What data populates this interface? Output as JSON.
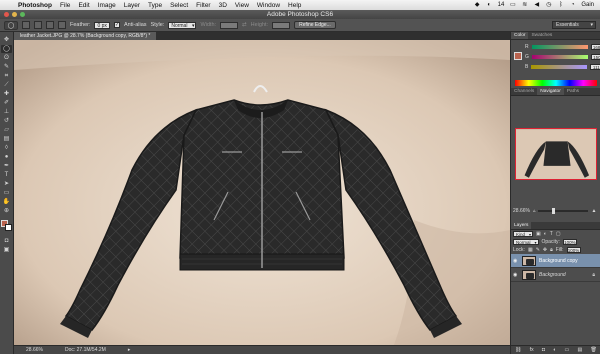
{
  "menubar": {
    "app_name": "Photoshop",
    "items": [
      "File",
      "Edit",
      "Image",
      "Layer",
      "Type",
      "Select",
      "Filter",
      "3D",
      "View",
      "Window",
      "Help"
    ],
    "status_number": "14",
    "user": "Gain"
  },
  "titlebar": {
    "title": "Adobe Photoshop CS6"
  },
  "options": {
    "feather_label": "Feather:",
    "feather_value": "0 px",
    "antialias_label": "Anti-alias",
    "style_label": "Style:",
    "style_value": "Normal",
    "width_label": "Width:",
    "height_label": "Height:",
    "refine_edge": "Refine Edge...",
    "workspace": "Essentials"
  },
  "document": {
    "tab_title": "leather Jacket.JPG @ 28.7% (Background copy, RGB/8*) *",
    "status_zoom": "28.66%",
    "status_doc": "Doc: 27.1M/54.2M"
  },
  "panels": {
    "color_tabs": [
      "Color",
      "Swatches"
    ],
    "color_values": {
      "r": "168",
      "g": "150",
      "b": "111"
    },
    "nav_tabs": [
      "Channels",
      "Navigator",
      "Paths"
    ],
    "nav_zoom": "28.66%",
    "layers_tab": "Layers",
    "kind_label": "Kind",
    "blend_mode": "Normal",
    "opacity_label": "Opacity:",
    "opacity_value": "100%",
    "lock_label": "Lock:",
    "fill_label": "Fill:",
    "fill_value": "100%",
    "layers": [
      {
        "name": "Background copy"
      },
      {
        "name": "Background"
      }
    ]
  },
  "colors": {
    "canvas_bg": "#cdb8a6",
    "selection_blue": "#7991ad",
    "foreground": "#b9634f"
  }
}
